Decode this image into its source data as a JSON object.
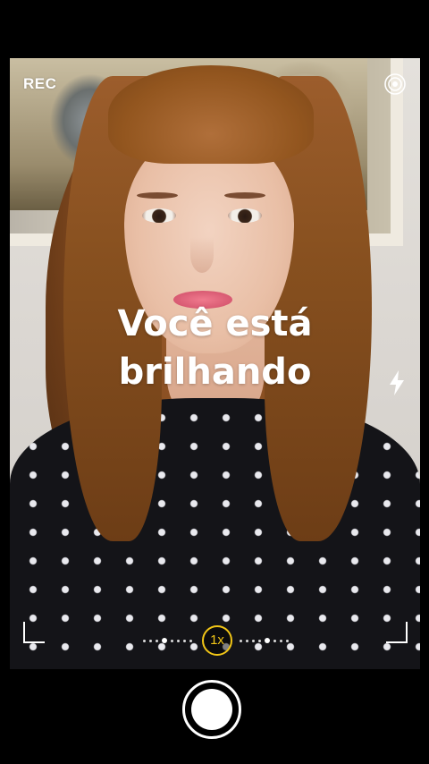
{
  "top_bar": {
    "rec_label": "REC",
    "settings_icon": "target-rings-icon"
  },
  "overlay": {
    "line1": "Você está",
    "line2": "brilhando"
  },
  "side_controls": {
    "flash_icon": "lightning-bolt-icon"
  },
  "zoom": {
    "label": "1x",
    "accent_color": "#f2c617"
  },
  "shutter": {
    "icon": "shutter-button"
  },
  "colors": {
    "background": "#000000",
    "overlay_text": "#ffffff"
  }
}
